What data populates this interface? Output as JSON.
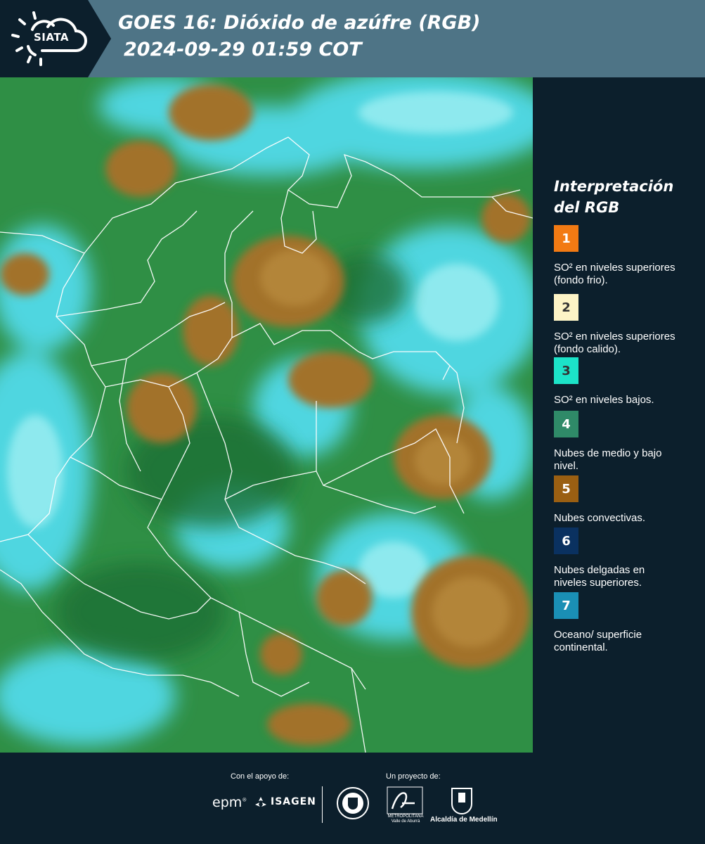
{
  "header": {
    "logo_text": "SIATA",
    "title_line1": "GOES 16: Dióxido de azúfre (RGB)",
    "title_line2": "2024-09-29 01:59 COT",
    "band_color": "#4e7486",
    "dark_color": "#0c1f2c"
  },
  "map": {
    "description_icon": "satellite-rgb-map"
  },
  "legend": {
    "title": "Interpretación del RGB",
    "items": [
      {
        "number": "1",
        "label": "SO² en niveles superiores (fondo frio).",
        "color": "#f27a13",
        "text_color": "#ffffff"
      },
      {
        "number": "2",
        "label": "SO² en niveles superiores (fondo calido).",
        "color": "#fdf4c6",
        "text_color": "#333333"
      },
      {
        "number": "3",
        "label": "SO² en niveles bajos.",
        "color": "#1ce3c8",
        "text_color": "#333333"
      },
      {
        "number": "4",
        "label": "Nubes de medio y bajo nivel.",
        "color": "#2f8a68",
        "text_color": "#ffffff"
      },
      {
        "number": "5",
        "label": "Nubes convectivas.",
        "color": "#9a5f12",
        "text_color": "#ffffff"
      },
      {
        "number": "6",
        "label": "Nubes delgadas en niveles superiores.",
        "color": "#0a3160",
        "text_color": "#ffffff"
      },
      {
        "number": "7",
        "label": "Oceano/ superficie continental.",
        "color": "#1a8fb5",
        "text_color": "#ffffff"
      }
    ]
  },
  "footer": {
    "support_caption": "Con el apoyo de:",
    "project_caption": "Un proyecto de:",
    "epm_text": "epm",
    "isagen_text": "ISAGEN",
    "area_text": "Área",
    "area_sub": "METROPOLITANA Valle de Aburrá",
    "alcaldia_text": "Alcaldía de Medellín"
  }
}
